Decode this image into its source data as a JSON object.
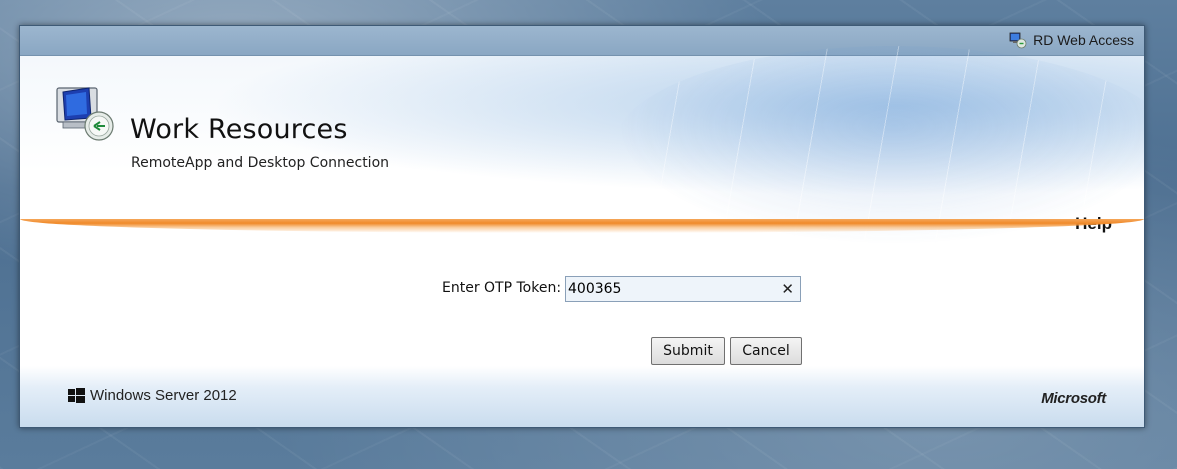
{
  "topbar": {
    "product_label": "RD Web Access",
    "icon": "rd-web-access-icon"
  },
  "header": {
    "title": "Work Resources",
    "subtitle": "RemoteApp and Desktop Connection",
    "help_link": "Help",
    "logo_icon": "remote-desktop-computer-icon"
  },
  "form": {
    "otp_label": "Enter OTP Token:",
    "otp_value": "400365",
    "clear_icon": "clear-x-icon",
    "submit_label": "Submit",
    "cancel_label": "Cancel"
  },
  "footer": {
    "os_label": "Windows Server 2012",
    "vendor_label": "Microsoft",
    "os_icon": "windows-flag-icon"
  },
  "colors": {
    "accent_orange": "#f08a2a",
    "topbar": "#8aa7c3"
  }
}
